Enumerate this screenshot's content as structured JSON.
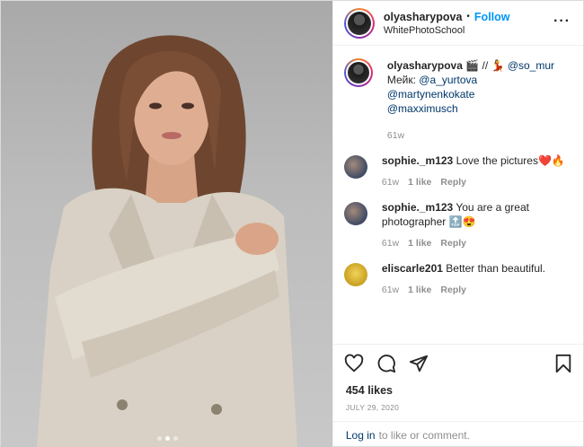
{
  "post": {
    "author": {
      "username": "olyasharypova",
      "follow_label": "Follow",
      "separator": "•",
      "location": "WhitePhotoSchool"
    },
    "more_icon": "more-horizontal-icon",
    "caption": {
      "username": "olyasharypova",
      "text_parts": [
        "🎬 // 💃 ",
        "@so_mur",
        "Мейк: ",
        "@a_yurtova",
        "@martynenkokate",
        "@maxximusch"
      ],
      "time": "61w"
    },
    "comments": [
      {
        "username": "sophie._m123",
        "text": "Love the pictures❤️🔥",
        "time": "61w",
        "likes": "1 like",
        "reply": "Reply",
        "avatar_color": "#5b6b86"
      },
      {
        "username": "sophie._m123",
        "text": "You are a great photographer 🔝😍",
        "time": "61w",
        "likes": "1 like",
        "reply": "Reply",
        "avatar_color": "#5b6b86"
      },
      {
        "username": "eliscarle201",
        "text": "Better than beautiful.",
        "time": "61w",
        "likes": "1 like",
        "reply": "Reply",
        "avatar_color": "#e0c24a"
      }
    ],
    "actions": {
      "like_icon": "heart-icon",
      "comment_icon": "comment-icon",
      "share_icon": "share-icon",
      "save_icon": "bookmark-icon"
    },
    "likes_count": "454 likes",
    "date": "JULY 29, 2020",
    "login": {
      "link": "Log in",
      "rest": "to like or comment."
    },
    "carousel": {
      "count": 3,
      "active_index": 1
    }
  }
}
